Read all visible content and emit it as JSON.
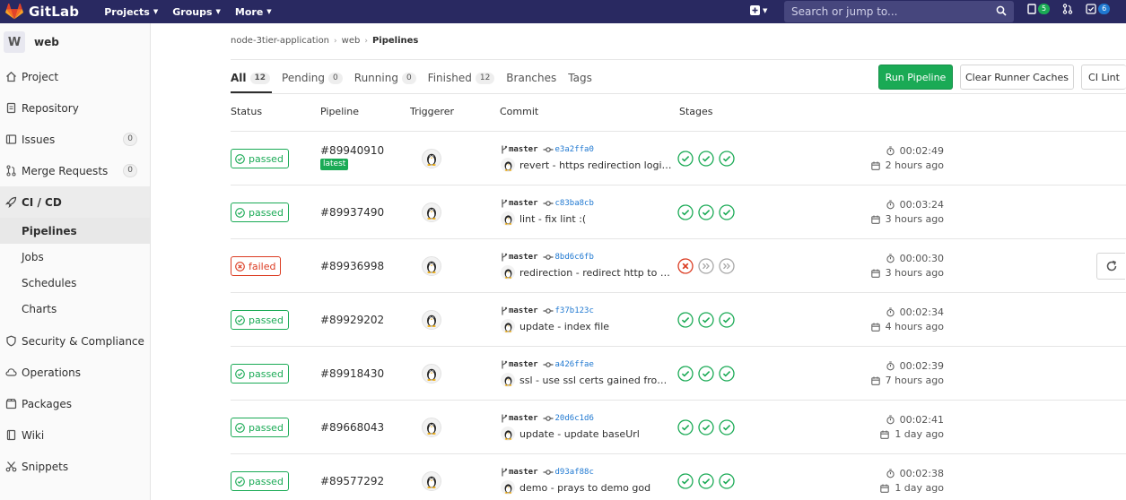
{
  "navbar": {
    "brand": "GitLab",
    "menus": [
      {
        "label": "Projects"
      },
      {
        "label": "Groups"
      },
      {
        "label": "More"
      }
    ],
    "search_placeholder": "Search or jump to...",
    "issues_count": "5",
    "todos_count": "6"
  },
  "sidebar": {
    "project_initial": "W",
    "project_name": "web",
    "items": [
      {
        "label": "Project",
        "icon": "home-icon"
      },
      {
        "label": "Repository",
        "icon": "doc-icon"
      },
      {
        "label": "Issues",
        "icon": "issues-icon",
        "count": "0"
      },
      {
        "label": "Merge Requests",
        "icon": "merge-request-icon",
        "count": "0"
      },
      {
        "label": "CI / CD",
        "icon": "rocket-icon",
        "active": true
      }
    ],
    "cicd_sub": [
      {
        "label": "Pipelines",
        "active": true
      },
      {
        "label": "Jobs"
      },
      {
        "label": "Schedules"
      },
      {
        "label": "Charts"
      }
    ],
    "items_after": [
      {
        "label": "Security & Compliance",
        "icon": "shield-icon"
      },
      {
        "label": "Operations",
        "icon": "cloud-icon"
      },
      {
        "label": "Packages",
        "icon": "package-icon"
      },
      {
        "label": "Wiki",
        "icon": "book-icon"
      },
      {
        "label": "Snippets",
        "icon": "scissors-icon"
      }
    ]
  },
  "breadcrumb": [
    "node-3tier-application",
    "web",
    "Pipelines"
  ],
  "tabs": [
    {
      "label": "All",
      "count": "12",
      "active": true
    },
    {
      "label": "Pending",
      "count": "0"
    },
    {
      "label": "Running",
      "count": "0"
    },
    {
      "label": "Finished",
      "count": "12"
    },
    {
      "label": "Branches"
    },
    {
      "label": "Tags"
    }
  ],
  "buttons": {
    "run": "Run Pipeline",
    "clear": "Clear Runner Caches",
    "lint": "CI Lint"
  },
  "columns": [
    "Status",
    "Pipeline",
    "Triggerer",
    "Commit",
    "Stages"
  ],
  "pipelines": [
    {
      "status": "passed",
      "id": "#89940910",
      "latest": "latest",
      "branch": "master",
      "sha": "e3a2ffa0",
      "message": "revert - https redirection logic ...",
      "stages": [
        "success",
        "success",
        "success"
      ],
      "duration": "00:02:49",
      "ago": "2 hours ago"
    },
    {
      "status": "passed",
      "id": "#89937490",
      "branch": "master",
      "sha": "c83ba8cb",
      "message": "lint - fix lint :(",
      "stages": [
        "success",
        "success",
        "success"
      ],
      "duration": "00:03:24",
      "ago": "3 hours ago"
    },
    {
      "status": "failed",
      "id": "#89936998",
      "branch": "master",
      "sha": "8bd6c6fb",
      "message": "redirection - redirect http to ht...",
      "stages": [
        "failed",
        "skipped",
        "skipped"
      ],
      "duration": "00:00:30",
      "ago": "3 hours ago",
      "retry": true
    },
    {
      "status": "passed",
      "id": "#89929202",
      "branch": "master",
      "sha": "f37b123c",
      "message": "update - index file",
      "stages": [
        "success",
        "success",
        "success"
      ],
      "duration": "00:02:34",
      "ago": "4 hours ago"
    },
    {
      "status": "passed",
      "id": "#89918430",
      "branch": "master",
      "sha": "a426ffae",
      "message": "ssl - use ssl certs gained from ...",
      "stages": [
        "success",
        "success",
        "success"
      ],
      "duration": "00:02:39",
      "ago": "7 hours ago"
    },
    {
      "status": "passed",
      "id": "#89668043",
      "branch": "master",
      "sha": "20d6c1d6",
      "message": "update - update baseUrl",
      "stages": [
        "success",
        "success",
        "success"
      ],
      "duration": "00:02:41",
      "ago": "1 day ago"
    },
    {
      "status": "passed",
      "id": "#89577292",
      "branch": "master",
      "sha": "d93af88c",
      "message": "demo - prays to demo god",
      "stages": [
        "success",
        "success",
        "success"
      ],
      "duration": "00:02:38",
      "ago": "1 day ago"
    }
  ],
  "colors": {
    "navbar": "#292961",
    "success": "#1aaa55",
    "failed": "#db3b21",
    "link": "#1f78d1"
  }
}
